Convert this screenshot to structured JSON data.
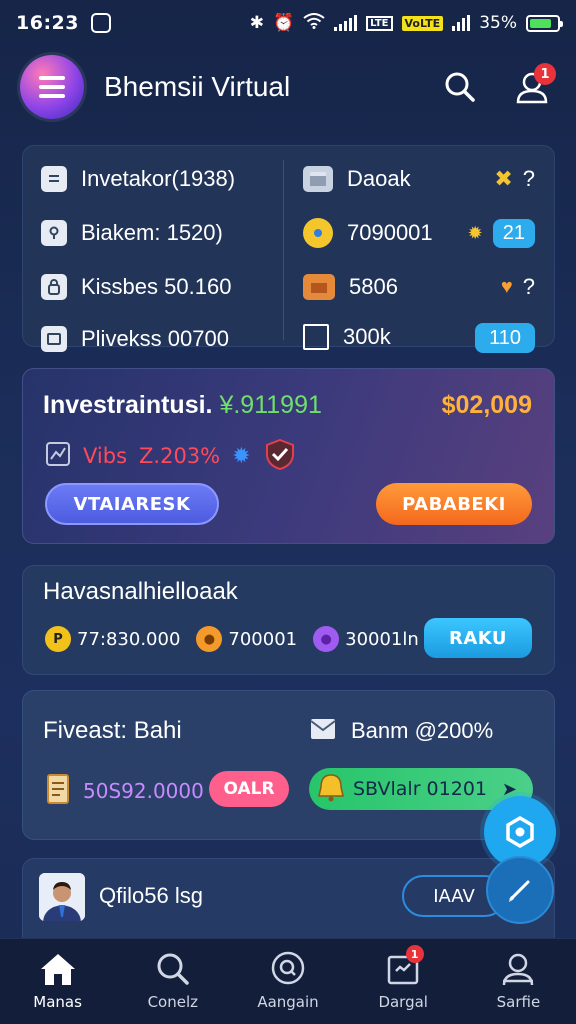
{
  "status_bar": {
    "time": "16:23",
    "volte": "VoLTE",
    "lte": "LTE",
    "battery_text": "35%",
    "battery_level": 0.8
  },
  "header": {
    "title": "Bhemsii Virtual",
    "notification_count": "1"
  },
  "summary": {
    "left": [
      {
        "label": "Invetakor(1938)",
        "icon": "document-icon"
      },
      {
        "label": "Biakem: 1520)",
        "icon": "key-icon"
      },
      {
        "label": "Kissbes 50.160",
        "icon": "lock-icon"
      },
      {
        "label": "Plivekss 00700",
        "icon": "card-icon"
      }
    ],
    "right": [
      {
        "label": "Daoak",
        "icon": "box-icon",
        "trailing": "?"
      },
      {
        "label": "7090001",
        "icon": "lock-icon",
        "badge": "21"
      },
      {
        "label": "5806",
        "icon": "briefcase-icon",
        "trailing": "?"
      },
      {
        "label": "300k",
        "icon": "folder-icon",
        "badge": "110"
      }
    ]
  },
  "investment": {
    "title": "Investraintusi.",
    "title_highlight": "¥.911991",
    "amount": "$02,009",
    "stat_label": "Vibs",
    "stat_value": "Z.203%",
    "primary_button": "VTAIARESK",
    "secondary_button": "PABABEKI"
  },
  "holdings": {
    "title": "Havasnalhielloaak",
    "coins": [
      {
        "symbol": "P",
        "value": "77:830.000",
        "color": "#f2c21a"
      },
      {
        "symbol": "●",
        "value": "700001",
        "color": "#f39a2a"
      },
      {
        "symbol": "●",
        "value": "30001ln",
        "color": "#a05bf0"
      }
    ],
    "button": "RAKU"
  },
  "forecast": {
    "title": "Fiveast: Bahi",
    "right_label": "Banm @200%",
    "amount": "50S92.0000",
    "pink_button": "OALR",
    "green_button": "SBVlalr 01201"
  },
  "profile": {
    "name": "Qfilo56 lsg",
    "button": "IAAV"
  },
  "bottom_nav": [
    {
      "label": "Manas",
      "icon": "home-icon"
    },
    {
      "label": "Conelz",
      "icon": "search-icon"
    },
    {
      "label": "Aangain",
      "icon": "search-circle-icon"
    },
    {
      "label": "Dargal",
      "icon": "inbox-icon",
      "badge": "1"
    },
    {
      "label": "Sarfie",
      "icon": "profile-icon"
    }
  ],
  "colors": {
    "accent_orange": "#ffb23b",
    "accent_green": "#6fe06a",
    "accent_cyan": "#2cabed",
    "negative": "#ff4a5a"
  }
}
